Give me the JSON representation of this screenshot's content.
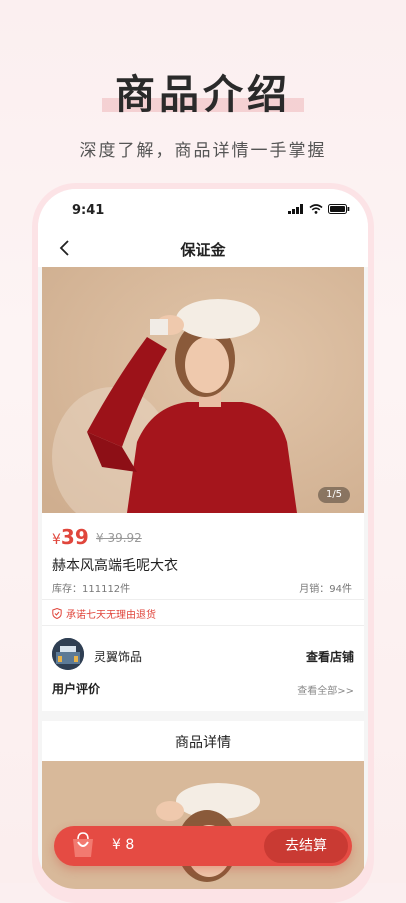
{
  "hero": {
    "title": "商品介绍",
    "subtitle": "深度了解，商品详情一手掌握"
  },
  "status_bar": {
    "time": "9:41"
  },
  "nav": {
    "title": "保证金"
  },
  "product": {
    "image_counter": "1/5",
    "currency": "¥",
    "price": "39",
    "original_price": "¥ 39.92",
    "name": "赫本风高端毛呢大衣",
    "stock": "库存：111112件",
    "sales": "月销：94件",
    "promise": "承诺七天无理由退货"
  },
  "shop": {
    "name": "灵翼饰品",
    "visit_label": "查看店铺"
  },
  "reviews": {
    "label": "用户评价",
    "view_all": "查看全部>>"
  },
  "detail": {
    "title": "商品详情"
  },
  "checkout": {
    "total": "¥ 8",
    "button_label": "去结算"
  },
  "colors": {
    "accent": "#e54b43",
    "price_red": "#e0463c",
    "background_pink": "#fbeff0",
    "photo_backdrop": "#d8b99a",
    "sweater_red": "#a5151c"
  }
}
